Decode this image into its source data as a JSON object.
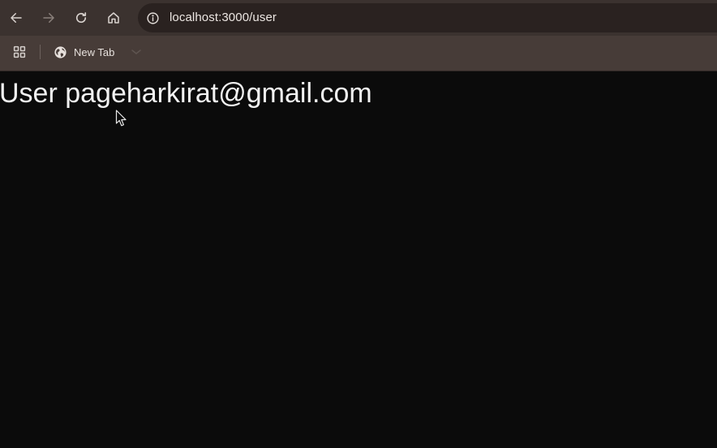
{
  "toolbar": {
    "back_icon": "arrow-left-icon",
    "forward_icon": "arrow-right-icon",
    "reload_icon": "reload-icon",
    "home_icon": "home-icon",
    "site_info_icon": "info-circle-icon",
    "url": "localhost:3000/user"
  },
  "bookmarks": {
    "apps_icon": "apps-grid-icon",
    "items": [
      {
        "icon": "globe-icon",
        "label": "New Tab"
      }
    ]
  },
  "page": {
    "heading": "User pageharkirat@gmail.com"
  },
  "colors": {
    "toolbar_bg": "#3b322f",
    "omnibox_bg": "#2a2220",
    "bookmarks_bg": "#473c38",
    "page_bg": "#0b0b0b",
    "heading_text": "#f2f2f2"
  }
}
